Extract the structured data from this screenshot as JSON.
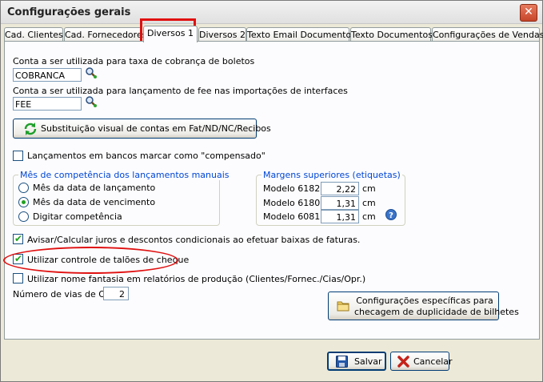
{
  "window": {
    "title": "Configurações gerais",
    "close_glyph": "✕"
  },
  "tabs": [
    {
      "label": "Cad. Clientes"
    },
    {
      "label": "Cad. Fornecedores"
    },
    {
      "label": "Diversos 1"
    },
    {
      "label": "Diversos 2"
    },
    {
      "label": "Texto Email Documentos"
    },
    {
      "label": "Texto Documentos"
    },
    {
      "label": "Configurações de Vendas"
    }
  ],
  "boletos": {
    "label": "Conta a ser utilizada para taxa de cobrança de boletos",
    "value": "COBRANCA"
  },
  "fee": {
    "label": "Conta a ser utilizada para lançamento de fee nas importações de interfaces",
    "value": "FEE"
  },
  "substituicao_button": {
    "label": "Substituição visual de contas em Fat/ND/NC/Recibos"
  },
  "compensado": {
    "label": "Lançamentos em bancos marcar como \"compensado\"",
    "checked": false
  },
  "competencia": {
    "legend": "Mês de competência dos lançamentos manuais",
    "options": [
      {
        "label": "Mês da data de lançamento",
        "selected": false
      },
      {
        "label": "Mês da data de vencimento",
        "selected": true
      },
      {
        "label": "Digitar competência",
        "selected": false
      }
    ]
  },
  "margens": {
    "legend": "Margens superiores (etiquetas)",
    "rows": [
      {
        "label": "Modelo 6182",
        "value": "2,22",
        "unit": "cm"
      },
      {
        "label": "Modelo 6180",
        "value": "1,31",
        "unit": "cm"
      },
      {
        "label": "Modelo 6081",
        "value": "1,31",
        "unit": "cm"
      }
    ]
  },
  "juros": {
    "label": "Avisar/Calcular juros e descontos condicionais ao efetuar baixas de faturas.",
    "checked": true
  },
  "taloes": {
    "label": "Utilizar controle de talões de cheque",
    "checked": true
  },
  "fantasia": {
    "label": "Utilizar nome fantasia em relatórios de produção (Clientes/Fornec./Cias/Opr.)",
    "checked": false
  },
  "vias": {
    "label": "Número de vias de OP",
    "value": "2"
  },
  "duplicidade_button": {
    "line1": "Configurações específicas para",
    "line2": "checagem de duplicidade de bilhetes"
  },
  "footer": {
    "save_label": "Salvar",
    "cancel_label": "Cancelar"
  },
  "colors": {
    "accent": "#0046D5",
    "highlight": "#E01010",
    "check": "#21A121"
  }
}
